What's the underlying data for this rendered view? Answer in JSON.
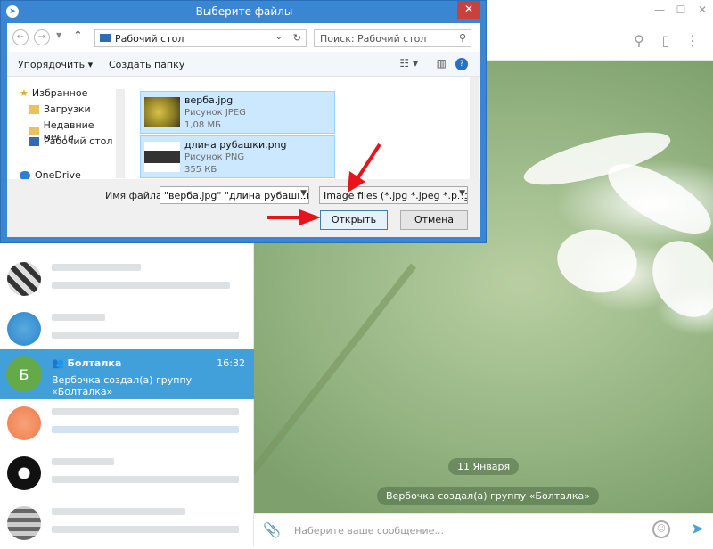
{
  "dialog": {
    "title": "Выберите файлы",
    "close_label": "✕",
    "address": "Рабочий стол",
    "search_placeholder": "Поиск: Рабочий стол",
    "toolbar": {
      "organize": "Упорядочить",
      "new_folder": "Создать папку"
    },
    "nav": [
      {
        "label": "Избранное",
        "icon": "star-icon"
      },
      {
        "label": "Загрузки",
        "icon": "downloads-folder-icon"
      },
      {
        "label": "Недавние места",
        "icon": "recent-places-icon"
      },
      {
        "label": "Рабочий стол",
        "icon": "desktop-icon"
      },
      {
        "label": "OneDrive",
        "icon": "onedrive-icon"
      }
    ],
    "files": [
      {
        "name": "верба.jpg",
        "type": "Рисунок JPEG",
        "size": "1,08 МБ"
      },
      {
        "name": "длина рубашки.png",
        "type": "Рисунок PNG",
        "size": "355 КБ"
      }
    ],
    "filename_label": "Имя файла:",
    "filename_value": "\"верба.jpg\" \"длина рубашки.pi",
    "filter_value": "Image files (*.jpg *.jpeg *.png *",
    "open_label": "Открыть",
    "cancel_label": "Отмена"
  },
  "telegram": {
    "active_chat": {
      "title": "Болталка",
      "time": "16:32",
      "preview": "Вербочка создал(а) группу «Болталка»",
      "avatar_letter": "Б"
    },
    "date_label": "11 Января",
    "service_message": "Вербочка создал(а) группу «Болталка»",
    "input_placeholder": "Наберите ваше сообщение..."
  },
  "colors": {
    "telegram_accent": "#419fd9",
    "dialog_frame": "#3b86d2",
    "avatar_green": "#65aa49",
    "annotation_red": "#e8141b"
  }
}
